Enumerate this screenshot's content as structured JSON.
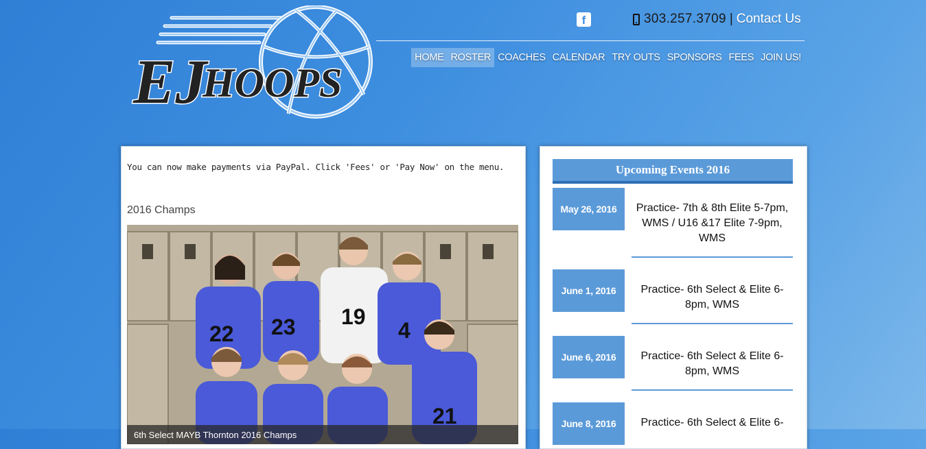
{
  "header": {
    "logo_text": "EJ HOOPS",
    "phone": "303.257.3709",
    "separator": "|",
    "contact_label": "Contact Us",
    "facebook_icon": "facebook-icon"
  },
  "nav": {
    "items": [
      "HOME",
      "ROSTER",
      "COACHES",
      "CALENDAR",
      "TRY OUTS",
      "SPONSORS",
      "FEES",
      "JOIN US!"
    ],
    "active": [
      "HOME",
      "ROSTER"
    ]
  },
  "main": {
    "notice": "You can now make payments via PayPal. Click 'Fees' or 'Pay Now' on the menu.",
    "section_title": "2016 Champs",
    "photo_caption": "6th Select MAYB Thornton 2016 Champs"
  },
  "events": {
    "title": "Upcoming Events 2016",
    "items": [
      {
        "date": "May 26, 2016",
        "desc": "Practice- 7th & 8th Elite 5-7pm, WMS / U16 &17 Elite 7-9pm, WMS"
      },
      {
        "date": "June 1, 2016",
        "desc": "Practice- 6th Select & Elite 6-8pm, WMS"
      },
      {
        "date": "June 6, 2016",
        "desc": "Practice- 6th Select & Elite 6-8pm, WMS"
      },
      {
        "date": "June 8, 2016",
        "desc": "Practice- 6th Select & Elite 6-"
      }
    ]
  },
  "colors": {
    "background": "#3f8fe0",
    "accent": "#5b9ad8",
    "accent_dark": "#2e6fb5"
  }
}
